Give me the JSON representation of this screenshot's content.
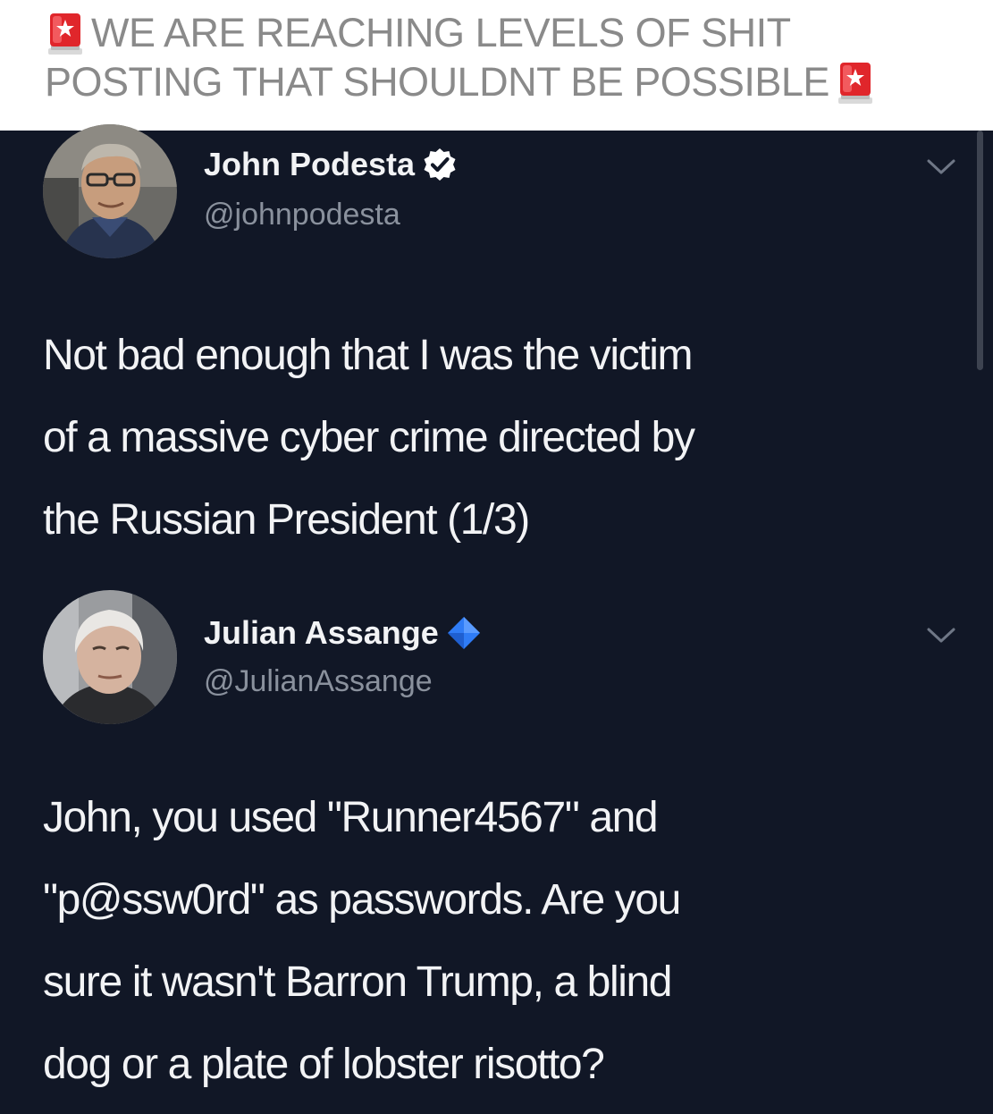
{
  "caption": {
    "line1": "WE ARE REACHING LEVELS OF SHIT",
    "line2": "POSTING THAT SHOULDNT BE POSSIBLE",
    "emoji": "police-car-light-icon"
  },
  "colors": {
    "background": "#111726",
    "name": "#f2f3f5",
    "handle": "#8a919d",
    "caption_text": "#8a8a8a",
    "verified_white": "#ffffff",
    "verified_blue": "#2f7cf6"
  },
  "tweets": [
    {
      "display_name": "John Podesta",
      "handle": "@johnpodesta",
      "verified_badge": "verified-check-icon",
      "text": "Not bad enough that I was the victim\nof a massive cyber crime directed by\nthe Russian President (1/3)"
    },
    {
      "display_name": "Julian Assange",
      "handle": "@JulianAssange",
      "verified_badge": "blue-diamond-icon",
      "text": "John, you used \"Runner4567\" and\n\"p@ssw0rd\" as passwords. Are you\nsure it wasn't Barron Trump, a blind\ndog or a plate of lobster risotto?"
    }
  ]
}
